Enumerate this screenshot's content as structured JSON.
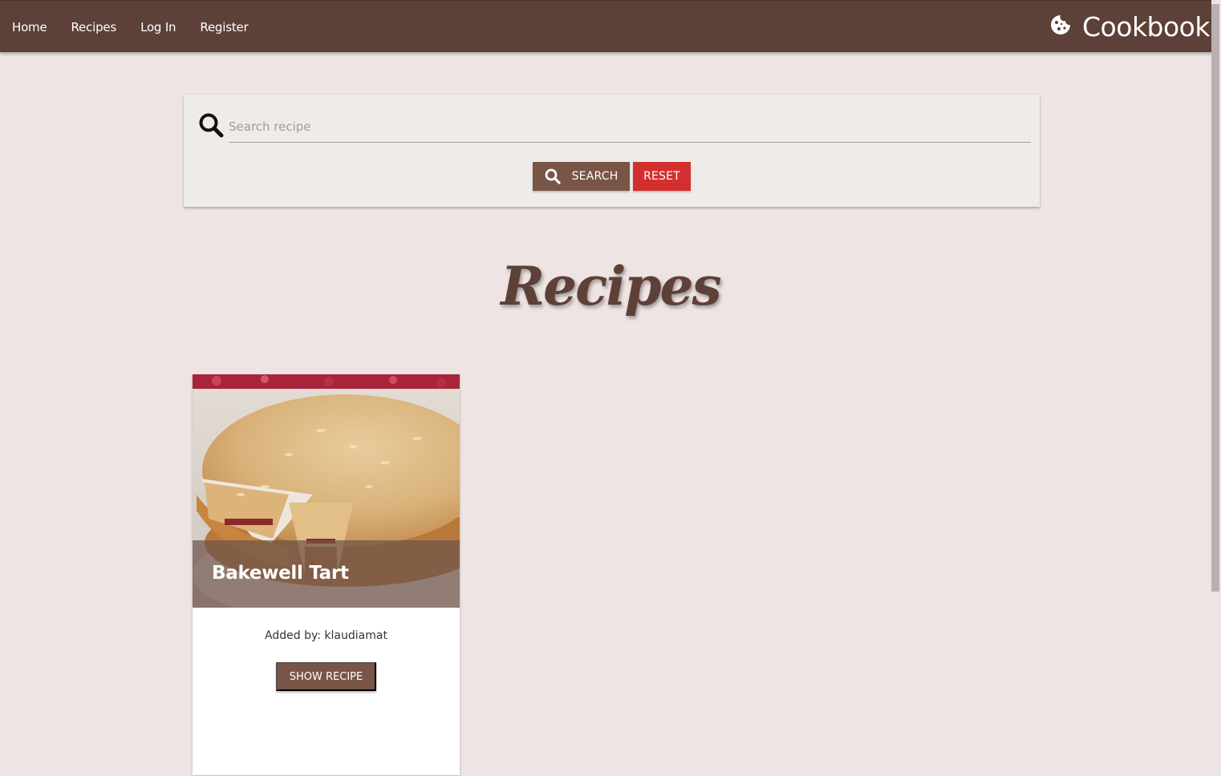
{
  "nav": {
    "links": [
      "Home",
      "Recipes",
      "Log In",
      "Register"
    ],
    "brand": "Cookbook",
    "brand_icon": "cookie-icon"
  },
  "search": {
    "placeholder": "Search recipe",
    "value": "",
    "search_label": "SEARCH",
    "reset_label": "RESET"
  },
  "main": {
    "title": "Recipes"
  },
  "recipes": [
    {
      "title": "Bakewell Tart",
      "added_by": "Added by: klaudiamat",
      "button_label": "SHOW RECIPE"
    }
  ],
  "colors": {
    "primary": "#5d4037",
    "button": "#795548",
    "reset": "#d32f2f",
    "background": "#eee4e3"
  }
}
